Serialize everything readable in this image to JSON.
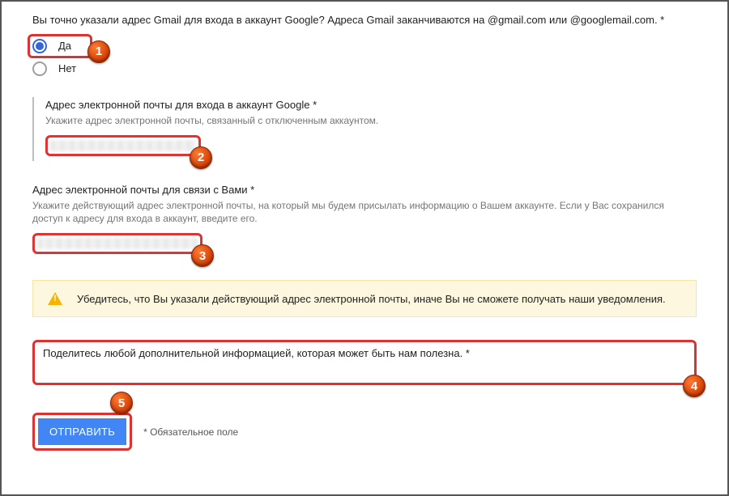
{
  "question": "Вы точно указали адрес Gmail для входа в аккаунт Google? Адреса Gmail заканчиваются на @gmail.com или @googlemail.com. *",
  "radios": {
    "yes": "Да",
    "no": "Нет",
    "selected": "yes"
  },
  "section1": {
    "title": "Адрес электронной почты для входа в аккаунт Google *",
    "help": "Укажите адрес электронной почты, связанный с отключенным аккаунтом."
  },
  "section2": {
    "title": "Адрес электронной почты для связи с Вами *",
    "help": "Укажите действующий адрес электронной почты, на который мы будем присылать информацию о Вашем аккаунте. Если у Вас сохранился доступ к адресу для входа в аккаунт, введите его."
  },
  "warning": "Убедитесь, что Вы указали действующий адрес электронной почты, иначе Вы не сможете получать наши уведомления.",
  "extra": {
    "title": "Поделитесь любой дополнительной информацией, которая может быть нам полезна. *"
  },
  "submit": "ОТПРАВИТЬ",
  "required_note": "* Обязательное поле",
  "markers": {
    "m1": "1",
    "m2": "2",
    "m3": "3",
    "m4": "4",
    "m5": "5"
  }
}
